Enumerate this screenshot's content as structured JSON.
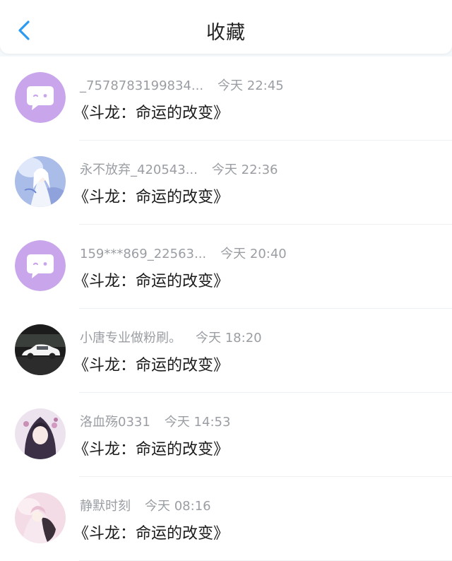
{
  "header": {
    "title": "收藏",
    "back_icon": "chevron-left-icon",
    "accent_color": "#2b9af3"
  },
  "favorites": [
    {
      "name": "_7578783199834...",
      "time": "今天 22:45",
      "book": "《斗龙：命运的改变》",
      "avatar": "default-chat-avatar"
    },
    {
      "name": "永不放弃_420543...",
      "time": "今天 22:36",
      "book": "《斗龙：命运的改变》",
      "avatar": "anime-girl-white-hair-avatar"
    },
    {
      "name": "159***869_22563...",
      "time": "今天 20:40",
      "book": "《斗龙：命运的改变》",
      "avatar": "default-chat-avatar"
    },
    {
      "name": "小唐专业做粉刷。",
      "time": "今天 18:20",
      "book": "《斗龙：命运的改变》",
      "avatar": "white-car-avatar"
    },
    {
      "name": "洛血殇0331",
      "time": "今天 14:53",
      "book": "《斗龙：命运的改变》",
      "avatar": "anime-girl-dark-hair-avatar"
    },
    {
      "name": "静默时刻",
      "time": "今天 08:16",
      "book": "《斗龙：命运的改变》",
      "avatar": "anime-girl-pink-avatar"
    }
  ]
}
